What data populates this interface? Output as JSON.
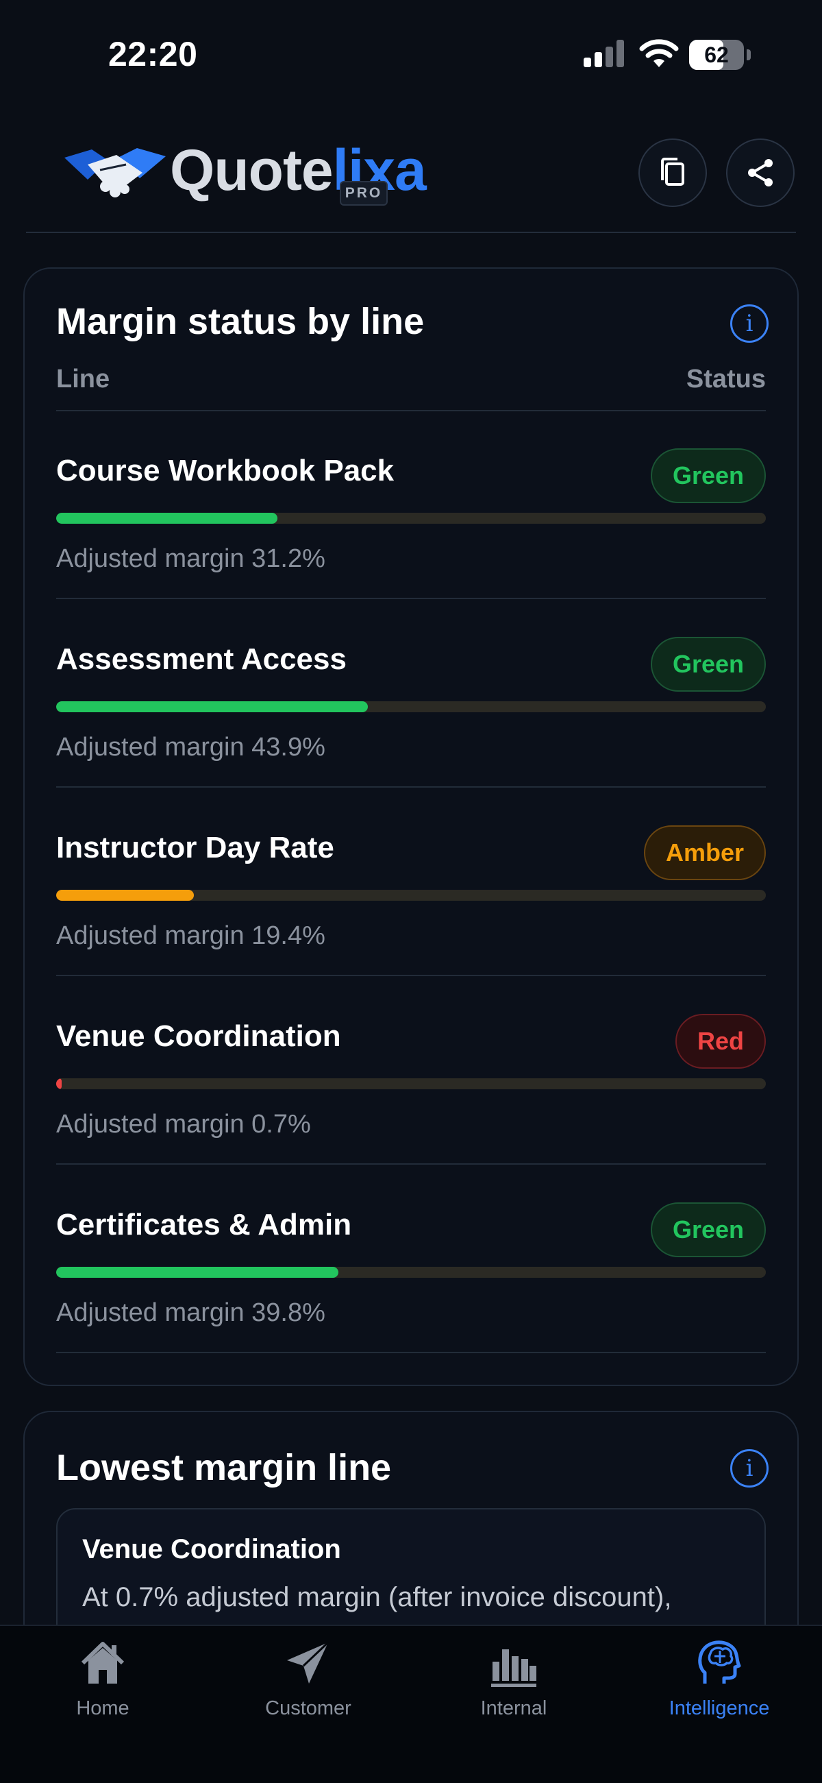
{
  "status_bar": {
    "time": "22:20",
    "battery_level": "62",
    "battery_fraction": 0.62
  },
  "header": {
    "logo_word_primary": "Quote",
    "logo_word_accent": "lixa",
    "logo_badge": "PRO",
    "actions": [
      {
        "name": "copy",
        "icon": "copy-icon"
      },
      {
        "name": "share",
        "icon": "share-icon"
      }
    ]
  },
  "margin_card": {
    "title": "Margin status by line",
    "col_line": "Line",
    "col_status": "Status",
    "rows": [
      {
        "name": "Course Workbook Pack",
        "status": "Green",
        "level": "green",
        "margin_text": "Adjusted margin 31.2%",
        "margin_pct": 31.2
      },
      {
        "name": "Assessment Access",
        "status": "Green",
        "level": "green",
        "margin_text": "Adjusted margin 43.9%",
        "margin_pct": 43.9
      },
      {
        "name": "Instructor Day Rate",
        "status": "Amber",
        "level": "amber",
        "margin_text": "Adjusted margin 19.4%",
        "margin_pct": 19.4
      },
      {
        "name": "Venue Coordination",
        "status": "Red",
        "level": "red",
        "margin_text": "Adjusted margin 0.7%",
        "margin_pct": 0.7
      },
      {
        "name": "Certificates & Admin",
        "status": "Green",
        "level": "green",
        "margin_text": "Adjusted margin 39.8%",
        "margin_pct": 39.8
      }
    ]
  },
  "lowest_card": {
    "title": "Lowest margin line",
    "line_name": "Venue Coordination",
    "description": "At 0.7% adjusted margin (after invoice discount),"
  },
  "tabs": [
    {
      "label": "Home",
      "icon": "home-icon",
      "active": false
    },
    {
      "label": "Customer",
      "icon": "paper-plane-icon",
      "active": false
    },
    {
      "label": "Internal",
      "icon": "bar-chart-icon",
      "active": false
    },
    {
      "label": "Intelligence",
      "icon": "brain-head-icon",
      "active": true
    }
  ],
  "colors": {
    "background": "#0a0e16",
    "accent": "#3b82f6",
    "green": "#22c55e",
    "amber": "#f59e0b",
    "red": "#ef4444"
  }
}
